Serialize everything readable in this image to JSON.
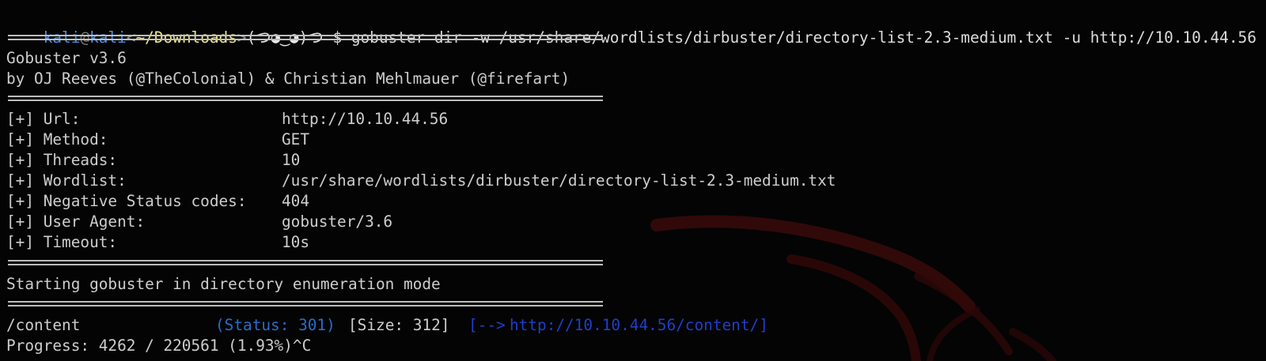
{
  "prompt": {
    "user": "kali",
    "at": "@",
    "host": "kali",
    "lt": "<",
    "path": "~/Downloads",
    "gt": ">",
    "face": "(つ◕‿◕)つ",
    "symbol": "$",
    "command": "gobuster dir -w /usr/share/wordlists/dirbuster/directory-list-2.3-medium.txt -u http://10.10.44.56"
  },
  "banner": {
    "version": "Gobuster v3.6",
    "authors": "by OJ Reeves (@TheColonial) & Christian Mehlmauer (@firefart)"
  },
  "config": [
    {
      "label": "[+] Url:",
      "value": "http://10.10.44.56"
    },
    {
      "label": "[+] Method:",
      "value": "GET"
    },
    {
      "label": "[+] Threads:",
      "value": "10"
    },
    {
      "label": "[+] Wordlist:",
      "value": "/usr/share/wordlists/dirbuster/directory-list-2.3-medium.txt"
    },
    {
      "label": "[+] Negative Status codes:",
      "value": "404"
    },
    {
      "label": "[+] User Agent:",
      "value": "gobuster/3.6"
    },
    {
      "label": "[+] Timeout:",
      "value": "10s"
    }
  ],
  "start_message": "Starting gobuster in directory enumeration mode",
  "result": {
    "path": "/content",
    "status": "(Status: 301)",
    "size": "[Size: 312]",
    "redirect_arrow": "[-->",
    "redirect_url": "http://10.10.44.56/content/]"
  },
  "progress": "Progress: 4262 / 220561 (1.93%)^C",
  "colors": {
    "background": "#040404",
    "text": "#cdcdcd",
    "user": "#4d8ee6",
    "path": "#f0e68c",
    "status": "#2b6ccc",
    "redirect": "#1f3fc8",
    "watermark": "#3a0a0a"
  }
}
